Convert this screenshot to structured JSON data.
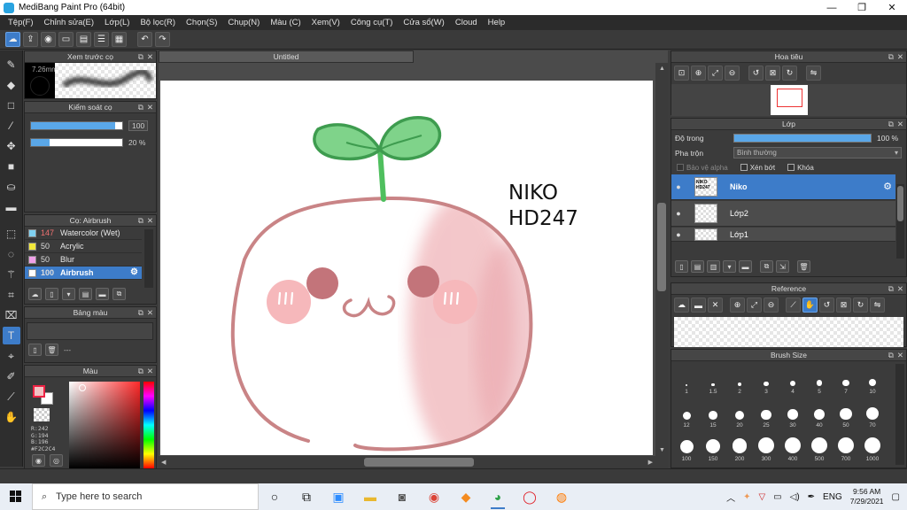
{
  "window": {
    "title": "MediBang Paint Pro (64bit)",
    "minimize": "—",
    "maximize": "❐",
    "close": "✕"
  },
  "menu": [
    "Tệp(F)",
    "Chỉnh sửa(E)",
    "Lớp(L)",
    "Bộ lọc(R)",
    "Chọn(S)",
    "Chụp(N)",
    "Màu (C)",
    "Xem(V)",
    "Công cụ(T)",
    "Cửa sổ(W)",
    "Cloud",
    "Help"
  ],
  "brush_preview": {
    "title": "Xem trước cọ",
    "size": "7.26mm"
  },
  "brush_control": {
    "title": "Kiểm soát cọ",
    "size_value": "100",
    "size_fraction": 0.92,
    "opacity_value": "20 %",
    "opacity_fraction": 0.2
  },
  "brush_list": {
    "title": "Cọ: Airbrush",
    "items": [
      {
        "size": "147",
        "name": "Watercolor (Wet)",
        "color": "#7fd0f0"
      },
      {
        "size": "50",
        "name": "Acrylic",
        "color": "#f2e83a"
      },
      {
        "size": "50",
        "name": "Blur",
        "color": "#f0a0e8"
      },
      {
        "size": "100",
        "name": "Airbrush",
        "color": "#ffffff"
      }
    ],
    "gear": "⚙"
  },
  "palette": {
    "title": "Bảng màu",
    "label": "---"
  },
  "color": {
    "title": "Màu",
    "rgb": "R:242\nG:194\nB:196\n#F2C2C4",
    "current": "#F2C2C4"
  },
  "document": {
    "tab": "Untitled",
    "text_line1": "NIKO",
    "text_line2": "HD247"
  },
  "navigator": {
    "title": "Hoa tiêu"
  },
  "layers": {
    "title": "Lớp",
    "opacity_label": "Độ trong",
    "opacity_value": "100 %",
    "blend_label": "Pha trộn",
    "blend_value": "Bình thường",
    "protect_alpha": "Bảo vệ alpha",
    "clipping": "Xén bớt",
    "lock": "Khóa",
    "items": [
      {
        "name": "Niko",
        "thumb": "NIKO HD247"
      },
      {
        "name": "Lớp2",
        "thumb": ""
      },
      {
        "name": "Lớp1",
        "thumb": ""
      }
    ]
  },
  "reference": {
    "title": "Reference"
  },
  "brush_size": {
    "title": "Brush Size",
    "sizes": [
      "1",
      "1.5",
      "2",
      "3",
      "4",
      "5",
      "7",
      "10",
      "12",
      "15",
      "20",
      "25",
      "30",
      "40",
      "50",
      "70",
      "100",
      "150",
      "200",
      "300",
      "400",
      "500",
      "700",
      "1000"
    ]
  },
  "taskbar": {
    "search_placeholder": "Type here to search",
    "language": "ENG",
    "time": "9:56 AM",
    "date": "7/29/2021"
  }
}
